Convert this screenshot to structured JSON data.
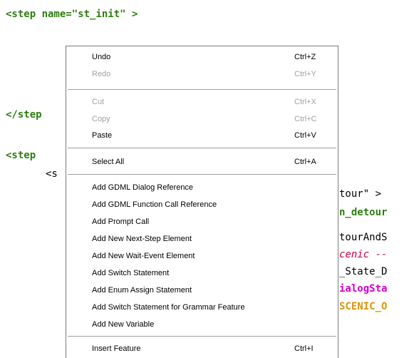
{
  "code": {
    "line1": "<step name=\"st_init\" >",
    "line2": "</step",
    "line3": "<step",
    "line4": "<s",
    "frag1": "tour\" >",
    "frag2": "n_detour",
    "frag3": "tourAndS",
    "frag4": "cenic --",
    "frag5": "_State_D",
    "frag6": "ialogSta",
    "frag7": "SCENIC_O"
  },
  "menu": {
    "undo": {
      "label": "Undo",
      "shortcut": "Ctrl+Z"
    },
    "redo": {
      "label": "Redo",
      "shortcut": "Ctrl+Y"
    },
    "cut": {
      "label": "Cut",
      "shortcut": "Ctrl+X"
    },
    "copy": {
      "label": "Copy",
      "shortcut": "Ctrl+C"
    },
    "paste": {
      "label": "Paste",
      "shortcut": "Ctrl+V"
    },
    "select_all": {
      "label": "Select All",
      "shortcut": "Ctrl+A"
    },
    "add_gdml_dialog": {
      "label": "Add GDML Dialog Reference"
    },
    "add_gdml_function": {
      "label": "Add GDML Function Call Reference"
    },
    "add_prompt": {
      "label": "Add Prompt Call"
    },
    "add_next_step": {
      "label": "Add New Next-Step Element"
    },
    "add_wait_event": {
      "label": "Add New Wait-Event Element"
    },
    "add_switch": {
      "label": "Add Switch Statement"
    },
    "add_enum_assign": {
      "label": "Add Enum Assign Statement"
    },
    "add_switch_grammar": {
      "label": "Add Switch Statement for Grammar Feature"
    },
    "add_variable": {
      "label": "Add New Variable"
    },
    "insert_feature": {
      "label": "Insert Feature",
      "shortcut": "Ctrl+I"
    }
  }
}
